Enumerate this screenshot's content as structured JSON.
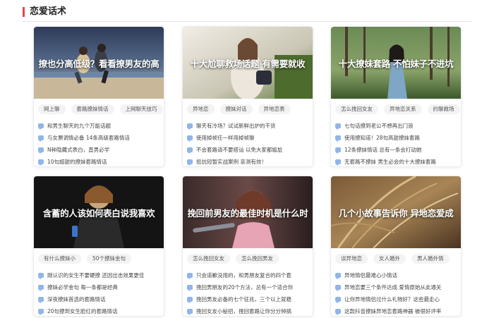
{
  "section": {
    "title": "恋爱话术"
  },
  "cards": [
    {
      "title": "撩也分高低级？看看撩男友的高",
      "tags": [
        "网上聊",
        "套路撩妹情话",
        "上网聊天技巧"
      ],
      "items": [
        "和男生聊天的九个万能话题",
        "与女票调情必备 14条高级套路情话",
        "N种隐藏式表白，直男必学",
        "10句超甜的撩妹套路情话"
      ]
    },
    {
      "title": "十大尬聊救场话题 有需要就收",
      "tags": [
        "异地恋",
        "撩妹对话",
        "异地恋表"
      ],
      "items": [
        "聊天有冷场？试试新鲜出炉的干货",
        "使用掉帧任一样用掉帧聊",
        "不会套路请不要搭讪 以免大家都尴尬",
        "抵抗短暂实战案例 亲测有效！"
      ]
    },
    {
      "title": "十大撩妹套路 不怕妹子不进坑",
      "tags": [
        "怎么挽回女友",
        "异地恋关系",
        "约聊救场"
      ],
      "items": [
        "七句话撩到老公不想再出门浪",
        "使用撩知道！28句高甜撩妹套路",
        "12条撩妹情话 总有一条会打动她",
        "无套路不撩妹 男生必会的十大撩妹套路"
      ]
    },
    {
      "title": "含蓄的人该如何表白说我喜欢",
      "tags": [
        "有什么撩妹小",
        "50个撩妹金句"
      ],
      "items": [
        "刚认识的女生不要硬撩 还因出击效果更佳",
        "撩妹必学金句 每一条都是经典",
        "深夜撩妹首选的套路情话",
        "20句撩到女生脸红的套路情话"
      ]
    },
    {
      "title": "挽回前男友的最佳时机是什么时",
      "tags": [
        "怎么挽回女友",
        "怎么挽回男友"
      ],
      "items": [
        "只会道歉没用的，和男朋友复合的四个套",
        "挽回男朋友的20个方法，总有一个适合你",
        "挽回男友必备的七个征兆，三个以上就稳",
        "挽回女友小秘招，挽回套路让你分分钟搞"
      ]
    },
    {
      "title": "几个小故事告诉你 异地恋爱成",
      "tags": [
        "谈异地恋",
        "女人婚外",
        "男人婚外情"
      ],
      "items": [
        "异地情侣最难心小情话",
        "异地恋要三个条件达成 爱情原始从此通关",
        "让你异地情侣过什么礼物好？这些最走心",
        "这款抖音撩妹异地恋套路神器 被很好评率"
      ]
    }
  ],
  "icons": {
    "list_item": "chat-bubble-icon"
  },
  "colors": {
    "accent": "#e8434d",
    "icon_blue": "#8fb6ea"
  }
}
